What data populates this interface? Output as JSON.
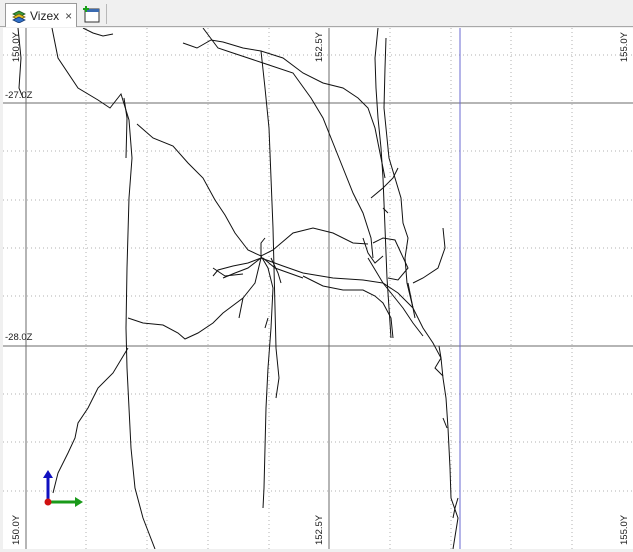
{
  "tab": {
    "title": "Vizex",
    "close_glyph": "×",
    "icon": "layers-icon"
  },
  "new_tab_icon": "new-window-icon",
  "grid": {
    "y_labels": [
      "150.0Y",
      "152.5Y",
      "155.0Y"
    ],
    "z_labels": [
      "-27.0Z",
      "-28.0Z"
    ]
  },
  "axes_colors": {
    "x": "#1a9a1a",
    "y": "#1010c0",
    "origin": "#d01010"
  },
  "colors": {
    "major_grid": "#6b6b6b",
    "minor_grid": "#b0b0b0",
    "highlight_line": "#6a6ad0",
    "drillholes": "#111111"
  }
}
